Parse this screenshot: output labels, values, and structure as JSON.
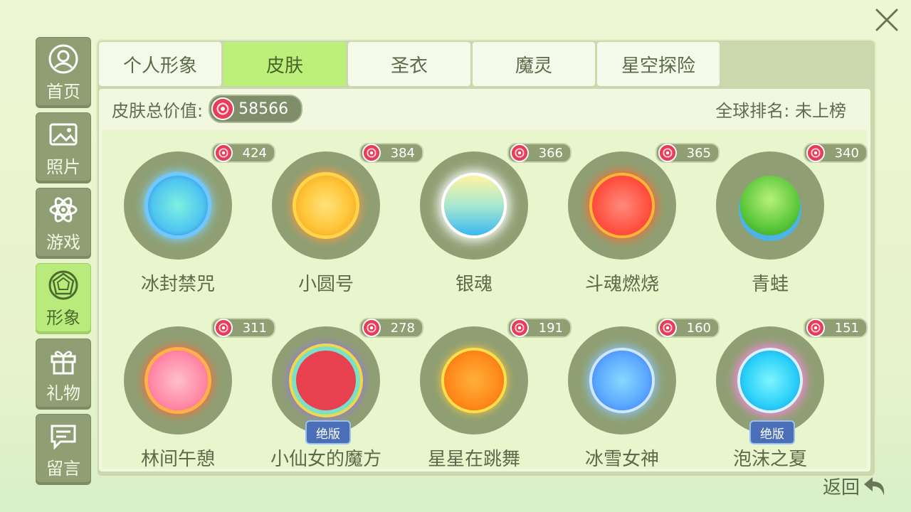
{
  "sidebar": {
    "items": [
      {
        "label": "首页",
        "icon": "user-icon"
      },
      {
        "label": "照片",
        "icon": "photo-icon"
      },
      {
        "label": "游戏",
        "icon": "atom-icon"
      },
      {
        "label": "形象",
        "icon": "gem-icon"
      },
      {
        "label": "礼物",
        "icon": "gift-icon"
      },
      {
        "label": "留言",
        "icon": "message-icon"
      }
    ],
    "active": "形象"
  },
  "tabs": [
    {
      "label": "个人形象"
    },
    {
      "label": "皮肤"
    },
    {
      "label": "圣衣"
    },
    {
      "label": "魔灵"
    },
    {
      "label": "星空探险"
    }
  ],
  "active_tab": "皮肤",
  "summary": {
    "total_label": "皮肤总价值:",
    "total_value": "58566",
    "rank_label": "全球排名: 未上榜"
  },
  "skins": [
    {
      "name": "冰封禁咒",
      "price": "424",
      "limited": ""
    },
    {
      "name": "小圆号",
      "price": "384",
      "limited": ""
    },
    {
      "name": "银魂",
      "price": "366",
      "limited": ""
    },
    {
      "name": "斗魂燃烧",
      "price": "365",
      "limited": ""
    },
    {
      "name": "青蛙",
      "price": "340",
      "limited": ""
    },
    {
      "name": "林间午憩",
      "price": "311",
      "limited": ""
    },
    {
      "name": "小仙女的魔方",
      "price": "278",
      "limited": "绝版"
    },
    {
      "name": "星星在跳舞",
      "price": "191",
      "limited": ""
    },
    {
      "name": "冰雪女神",
      "price": "160",
      "limited": ""
    },
    {
      "name": "泡沫之夏",
      "price": "151",
      "limited": "绝版"
    }
  ],
  "back_label": "返回",
  "colors": {
    "active_green": "#bdef7b",
    "sidebar_olive": "#8f9f73",
    "candy_red": "#e83c5a"
  }
}
